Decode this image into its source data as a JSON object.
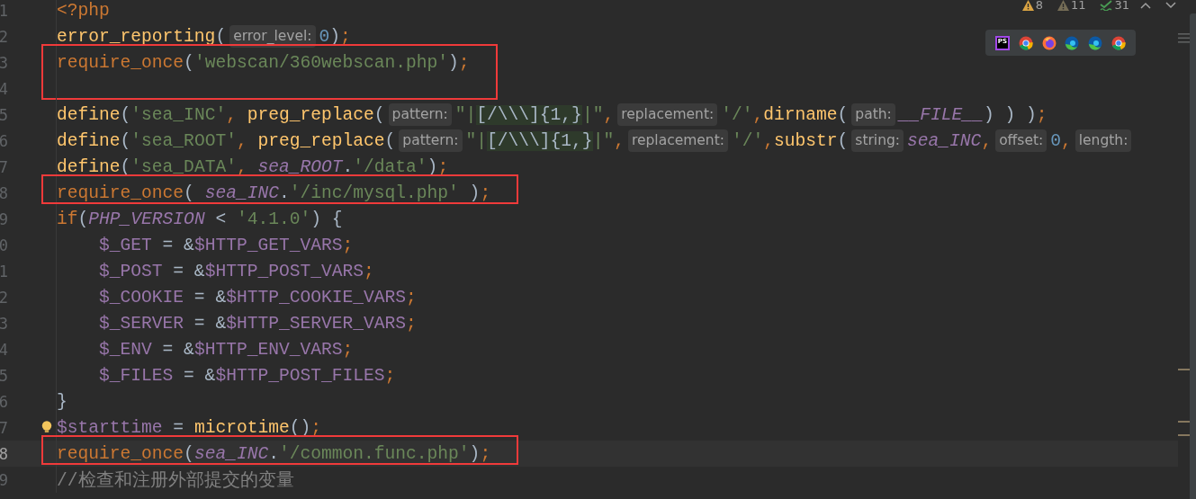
{
  "inspections": [
    {
      "kind": "warning",
      "count": "8"
    },
    {
      "kind": "weak_warning",
      "count": "11"
    },
    {
      "kind": "typo",
      "count": "31"
    }
  ],
  "browsers": [
    {
      "kind": "phpstorm",
      "label": "PS"
    },
    {
      "kind": "chrome"
    },
    {
      "kind": "firefox"
    },
    {
      "kind": "edge"
    },
    {
      "kind": "edge"
    },
    {
      "kind": "chrome"
    }
  ],
  "lines": [
    {
      "number": "1",
      "tokens": [
        {
          "kind": "keyword",
          "text": "<?php"
        }
      ]
    },
    {
      "number": "2",
      "tokens": [
        {
          "kind": "func",
          "text": "error_reporting"
        },
        {
          "kind": "plain",
          "text": "("
        },
        {
          "kind": "hint",
          "text": "error_level:"
        },
        {
          "kind": "number",
          "text": "0"
        },
        {
          "kind": "plain",
          "text": ")"
        },
        {
          "kind": "keyword",
          "text": ";"
        }
      ]
    },
    {
      "number": "3",
      "annotated": true,
      "tokens": [
        {
          "kind": "keyword",
          "text": "require_once"
        },
        {
          "kind": "plain",
          "text": "("
        },
        {
          "kind": "string",
          "text": "'webscan/360webscan.php'"
        },
        {
          "kind": "plain",
          "text": ")"
        },
        {
          "kind": "keyword",
          "text": ";"
        }
      ]
    },
    {
      "number": "4",
      "annotated": true
    },
    {
      "number": "5",
      "tokens": [
        {
          "kind": "func",
          "text": "define"
        },
        {
          "kind": "plain",
          "text": "("
        },
        {
          "kind": "string",
          "text": "'sea_INC'"
        },
        {
          "kind": "keyword",
          "text": ", "
        },
        {
          "kind": "func",
          "text": "preg_replace"
        },
        {
          "kind": "plain",
          "text": "("
        },
        {
          "kind": "hint",
          "text": "pattern:"
        },
        {
          "kind": "string",
          "text": "\"|"
        },
        {
          "kind": "regex",
          "text": "[/\\\\\\]{1,}"
        },
        {
          "kind": "string",
          "text": "|\""
        },
        {
          "kind": "keyword",
          "text": ","
        },
        {
          "kind": "hint",
          "text": "replacement:"
        },
        {
          "kind": "string",
          "text": "'/'"
        },
        {
          "kind": "keyword",
          "text": ","
        },
        {
          "kind": "func",
          "text": "dirname"
        },
        {
          "kind": "plain",
          "text": "("
        },
        {
          "kind": "hint",
          "text": "path:"
        },
        {
          "kind": "constant",
          "text": "__FILE__"
        },
        {
          "kind": "plain",
          "text": ") ) )"
        },
        {
          "kind": "keyword",
          "text": ";"
        }
      ]
    },
    {
      "number": "6",
      "tokens": [
        {
          "kind": "func",
          "text": "define"
        },
        {
          "kind": "plain",
          "text": "("
        },
        {
          "kind": "string",
          "text": "'sea_ROOT'"
        },
        {
          "kind": "keyword",
          "text": ", "
        },
        {
          "kind": "func",
          "text": "preg_replace"
        },
        {
          "kind": "plain",
          "text": "("
        },
        {
          "kind": "hint",
          "text": "pattern:"
        },
        {
          "kind": "string",
          "text": "\"|"
        },
        {
          "kind": "regex",
          "text": "[/\\\\\\]{1,}"
        },
        {
          "kind": "string",
          "text": "|\""
        },
        {
          "kind": "keyword",
          "text": ","
        },
        {
          "kind": "hint",
          "text": "replacement:"
        },
        {
          "kind": "string",
          "text": "'/'"
        },
        {
          "kind": "keyword",
          "text": ","
        },
        {
          "kind": "func",
          "text": "substr"
        },
        {
          "kind": "plain",
          "text": "("
        },
        {
          "kind": "hint",
          "text": "string:"
        },
        {
          "kind": "constant",
          "text": "sea_INC"
        },
        {
          "kind": "keyword",
          "text": ","
        },
        {
          "kind": "hint",
          "text": "offset:"
        },
        {
          "kind": "number",
          "text": "0"
        },
        {
          "kind": "keyword",
          "text": ","
        },
        {
          "kind": "hint",
          "text": "length:"
        }
      ]
    },
    {
      "number": "7",
      "tokens": [
        {
          "kind": "func",
          "text": "define"
        },
        {
          "kind": "plain",
          "text": "("
        },
        {
          "kind": "string",
          "text": "'sea_DATA'"
        },
        {
          "kind": "keyword",
          "text": ", "
        },
        {
          "kind": "constant",
          "text": "sea_ROOT"
        },
        {
          "kind": "plain",
          "text": "."
        },
        {
          "kind": "string",
          "text": "'/data'"
        },
        {
          "kind": "plain",
          "text": ")"
        },
        {
          "kind": "keyword",
          "text": ";"
        }
      ]
    },
    {
      "number": "8",
      "annotated": true,
      "tokens": [
        {
          "kind": "keyword",
          "text": "require_once"
        },
        {
          "kind": "plain",
          "text": "( "
        },
        {
          "kind": "constant",
          "text": "sea_INC"
        },
        {
          "kind": "plain",
          "text": "."
        },
        {
          "kind": "string",
          "text": "'/inc/mysql.php'"
        },
        {
          "kind": "plain",
          "text": " )"
        },
        {
          "kind": "keyword",
          "text": ";"
        }
      ]
    },
    {
      "number": "9",
      "tokens": [
        {
          "kind": "keyword",
          "text": "if"
        },
        {
          "kind": "plain",
          "text": "("
        },
        {
          "kind": "constant",
          "text": "PHP_VERSION"
        },
        {
          "kind": "plain",
          "text": " < "
        },
        {
          "kind": "string",
          "text": "'4.1.0'"
        },
        {
          "kind": "plain",
          "text": ") {"
        }
      ]
    },
    {
      "number": "0",
      "indented": true,
      "tokens": [
        {
          "kind": "variable",
          "text": "$_GET"
        },
        {
          "kind": "plain",
          "text": " = &"
        },
        {
          "kind": "variable",
          "text": "$HTTP_GET_VARS"
        },
        {
          "kind": "keyword",
          "text": ";"
        }
      ]
    },
    {
      "number": "1",
      "indented": true,
      "tokens": [
        {
          "kind": "variable",
          "text": "$_POST"
        },
        {
          "kind": "plain",
          "text": " = &"
        },
        {
          "kind": "variable",
          "text": "$HTTP_POST_VARS"
        },
        {
          "kind": "keyword",
          "text": ";"
        }
      ]
    },
    {
      "number": "2",
      "indented": true,
      "tokens": [
        {
          "kind": "variable",
          "text": "$_COOKIE"
        },
        {
          "kind": "plain",
          "text": " = &"
        },
        {
          "kind": "variable",
          "text": "$HTTP_COOKIE_VARS"
        },
        {
          "kind": "keyword",
          "text": ";"
        }
      ]
    },
    {
      "number": "3",
      "indented": true,
      "tokens": [
        {
          "kind": "variable",
          "text": "$_SERVER"
        },
        {
          "kind": "plain",
          "text": " = &"
        },
        {
          "kind": "variable",
          "text": "$HTTP_SERVER_VARS"
        },
        {
          "kind": "keyword",
          "text": ";"
        }
      ]
    },
    {
      "number": "4",
      "indented": true,
      "tokens": [
        {
          "kind": "variable",
          "text": "$_ENV"
        },
        {
          "kind": "plain",
          "text": " = &"
        },
        {
          "kind": "variable",
          "text": "$HTTP_ENV_VARS"
        },
        {
          "kind": "keyword",
          "text": ";"
        }
      ]
    },
    {
      "number": "5",
      "indented": true,
      "tokens": [
        {
          "kind": "variable",
          "text": "$_FILES"
        },
        {
          "kind": "plain",
          "text": " = &"
        },
        {
          "kind": "variable",
          "text": "$HTTP_POST_FILES"
        },
        {
          "kind": "keyword",
          "text": ";"
        }
      ]
    },
    {
      "number": "6",
      "tokens": [
        {
          "kind": "plain",
          "text": "}"
        }
      ]
    },
    {
      "number": "7",
      "bulb": true,
      "tokens": [
        {
          "kind": "variable",
          "text": "$starttime"
        },
        {
          "kind": "plain",
          "text": " = "
        },
        {
          "kind": "func",
          "text": "microtime"
        },
        {
          "kind": "plain",
          "text": "()"
        },
        {
          "kind": "keyword",
          "text": ";"
        }
      ]
    },
    {
      "number": "8",
      "annotated": true,
      "current": true,
      "tokens": [
        {
          "kind": "keyword",
          "text": "require_once"
        },
        {
          "kind": "plain",
          "text": "("
        },
        {
          "kind": "constant",
          "text": "sea_INC"
        },
        {
          "kind": "plain",
          "text": "."
        },
        {
          "kind": "string",
          "text": "'/common.func.php'"
        },
        {
          "kind": "plain",
          "text": ")"
        },
        {
          "kind": "keyword",
          "text": ";"
        }
      ]
    },
    {
      "number": "9",
      "tokens": [
        {
          "kind": "comment",
          "text": "//检查和注册外部提交的变量"
        }
      ]
    }
  ]
}
